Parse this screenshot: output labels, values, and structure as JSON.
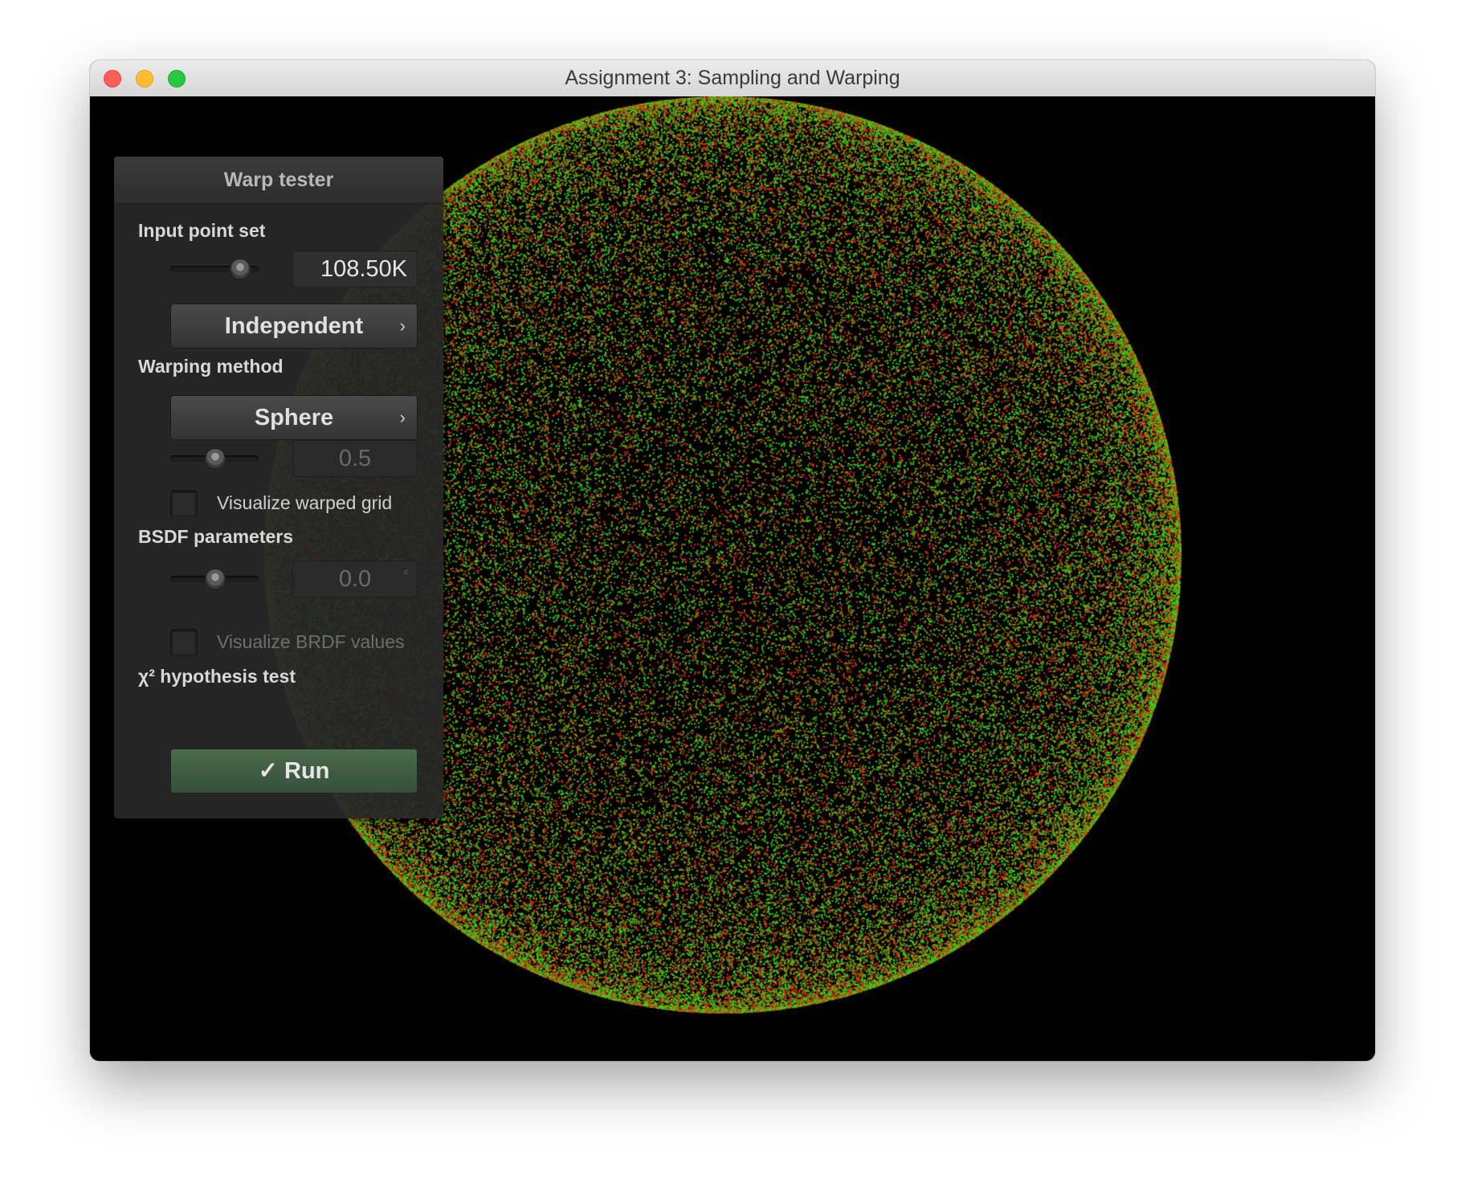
{
  "window": {
    "title": "Assignment 3: Sampling and Warping"
  },
  "panel": {
    "title": "Warp tester",
    "input_point_set": {
      "label": "Input point set",
      "slider_value": 0.78,
      "count": "108.50K",
      "pattern": "Independent"
    },
    "warping_method": {
      "label": "Warping method",
      "method": "Sphere",
      "slider_value": 0.5,
      "parameter": "0.5",
      "grid_label": "Visualize warped grid"
    },
    "bsdf": {
      "label": "BSDF parameters",
      "slider_value": 0.5,
      "angle": "0.0",
      "angle_unit": "°",
      "brdf_label": "Visualize BRDF values"
    },
    "chi2": {
      "label": "χ² hypothesis test",
      "run_icon": "✓",
      "run_label": "Run"
    }
  },
  "colors": {
    "point_green": "#3fcc1a",
    "point_red": "#d9360f",
    "run_button": "#3f5d43"
  }
}
